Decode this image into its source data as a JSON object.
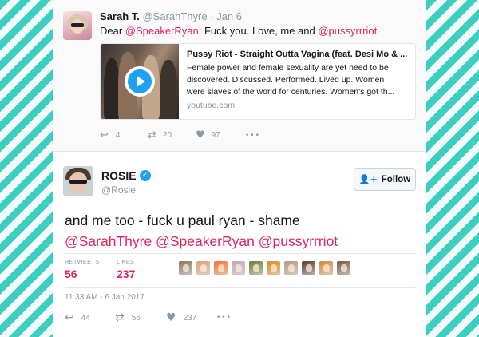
{
  "reply_tweet": {
    "name": "Sarah T.",
    "handle": "@SarahThyre",
    "separator": "·",
    "date": "Jan 6",
    "text_prefix": "Dear ",
    "mention1": "@SpeakerRyan",
    "text_middle": ": Fuck you. Love, me and ",
    "mention2": "@pussyrrriot",
    "media": {
      "title": "Pussy Riot - Straight Outta Vagina (feat. Desi Mo & ...",
      "desc_lines": [
        "Female power and female sexuality are yet need to be",
        "discovered. Discussed. Performed. Lived up. Women",
        "were slaves of the world for centuries. Women's got th..."
      ],
      "domain": "youtube.com"
    },
    "actions": {
      "reply_count": "4",
      "retweet_count": "20",
      "like_count": "97",
      "more": "•••"
    }
  },
  "main_tweet": {
    "name": "ROSIE",
    "handle": "@Rosie",
    "follow_label": "Follow",
    "text_line1": "and me too - fuck u paul ryan - shame",
    "text_line2": "@SarahThyre @SpeakerRyan @pussyrrriot",
    "stats": {
      "retweets_label": "RETWEETS",
      "retweets": "56",
      "likes_label": "LIKES",
      "likes": "237"
    },
    "likers": [
      {
        "color": "#8a7a5c"
      },
      {
        "color": "#d9a37a"
      },
      {
        "color": "#ff6f2c"
      },
      {
        "color": "#c9a8b6"
      },
      {
        "color": "#6f7f3a"
      },
      {
        "color": "#e08a1e"
      },
      {
        "color": "#b59a7a"
      },
      {
        "color": "#5a4030"
      },
      {
        "color": "#d68a3a"
      },
      {
        "color": "#7a5a48"
      }
    ],
    "timestamp": "11:33 AM - 6 Jan 2017",
    "actions": {
      "reply_count": "44",
      "retweet_count": "56",
      "like_count": "237",
      "more": "•••"
    }
  },
  "colors": {
    "mention": "#e0245e",
    "accent": "#1da1f2",
    "muted": "#8899a6",
    "stripe": "#3ccfbf"
  },
  "icons": {
    "reply": "reply-icon",
    "retweet": "retweet-icon",
    "like": "heart-icon",
    "more": "more-icon",
    "verified": "verified-badge-icon",
    "follow": "add-user-icon",
    "play": "play-icon"
  }
}
